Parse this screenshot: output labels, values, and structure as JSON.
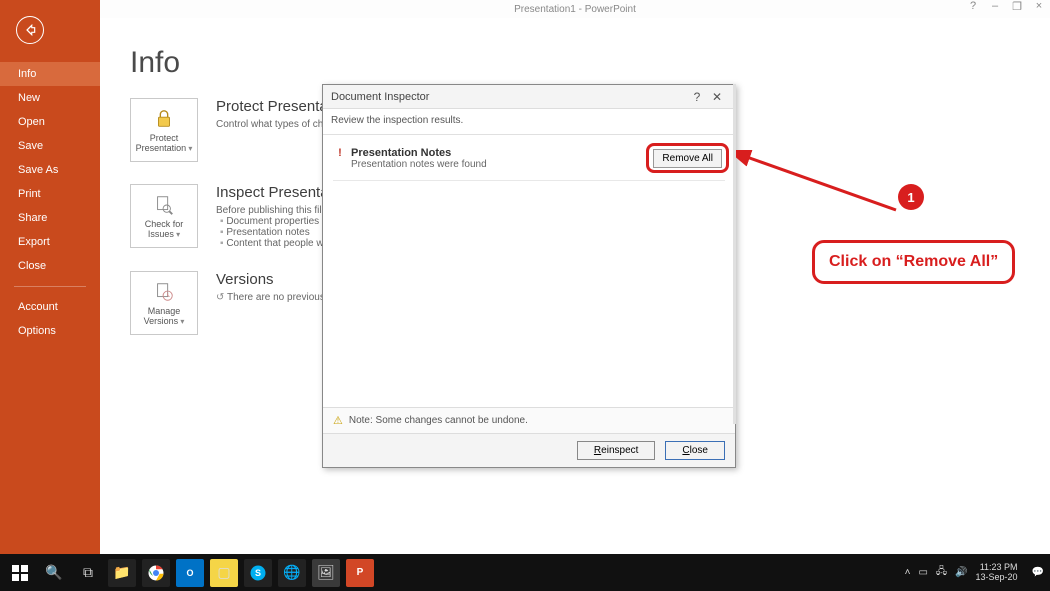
{
  "app_title": "Presentation1 - PowerPoint",
  "window_buttons": {
    "help": "?",
    "min": "–",
    "restore": "❐",
    "close": "×"
  },
  "sidebar": {
    "items": [
      {
        "label": "Info",
        "selected": true
      },
      {
        "label": "New"
      },
      {
        "label": "Open"
      },
      {
        "label": "Save"
      },
      {
        "label": "Save As"
      },
      {
        "label": "Print"
      },
      {
        "label": "Share"
      },
      {
        "label": "Export"
      },
      {
        "label": "Close"
      }
    ],
    "footer": [
      {
        "label": "Account"
      },
      {
        "label": "Options"
      }
    ]
  },
  "page": {
    "title": "Info",
    "sections": [
      {
        "card_label": "Protect Presentation",
        "heading": "Protect Presentation",
        "desc": "Control what types of changes people can make to this presentation."
      },
      {
        "card_label": "Check for Issues",
        "heading": "Inspect Presentation",
        "desc": "Before publishing this file, be aware that it contains:",
        "bullets": [
          "Document properties and author's name",
          "Presentation notes",
          "Content that people with disabilities are unable to read"
        ]
      },
      {
        "card_label": "Manage Versions",
        "heading": "Versions",
        "desc": "There are no previous versions of this file."
      }
    ]
  },
  "dialog": {
    "title": "Document Inspector",
    "subtitle": "Review the inspection results.",
    "result": {
      "title": "Presentation Notes",
      "desc": "Presentation notes were found",
      "remove_label": "Remove All"
    },
    "note": "Note: Some changes cannot be undone.",
    "reinspect_label": "Reinspect",
    "close_label": "Close"
  },
  "annotation": {
    "badge": "1",
    "text": "Click on “Remove All”"
  },
  "taskbar": {
    "time": "11:23 PM",
    "date": "13-Sep-20"
  }
}
